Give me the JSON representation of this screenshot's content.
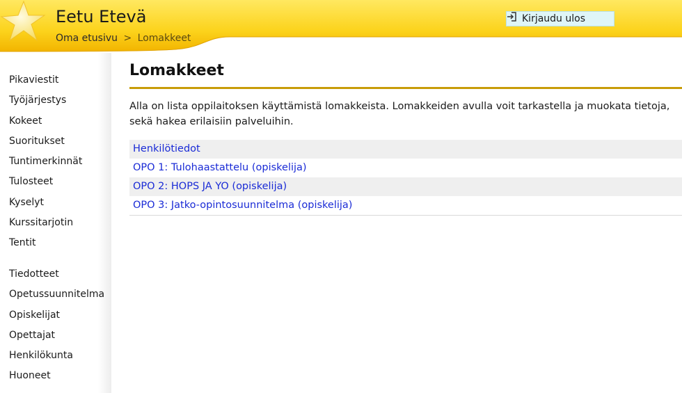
{
  "header": {
    "user_name": "Eetu Etevä",
    "breadcrumb": {
      "home": "Oma etusivu",
      "separator": ">",
      "current": "Lomakkeet"
    },
    "logout_label": "Kirjaudu ulos",
    "colors": {
      "banner_top": "#ffe45a",
      "banner_bottom": "#f5b800",
      "accent": "#c89c08"
    }
  },
  "sidebar": {
    "group1": [
      "Pikaviestit",
      "Työjärjestys",
      "Kokeet",
      "Suoritukset",
      "Tuntimerkinnät",
      "Tulosteet",
      "Kyselyt",
      "Kurssitarjotin",
      "Tentit"
    ],
    "group2": [
      "Tiedotteet",
      "Opetussuunnitelma",
      "Opiskelijat",
      "Opettajat",
      "Henkilökunta",
      "Huoneet"
    ]
  },
  "main": {
    "title": "Lomakkeet",
    "intro": "Alla on lista oppilaitoksen käyttämistä lomakkeista. Lomakkeiden avulla voit tarkastella ja muokata tietoja, sekä hakea erilaisiin palveluihin.",
    "forms": [
      "Henkilötiedot",
      "OPO 1: Tulohaastattelu (opiskelija)",
      "OPO 2: HOPS JA YO (opiskelija)",
      "OPO 3: Jatko-opintosuunnitelma (opiskelija)"
    ],
    "link_color": "#1a2bd6"
  }
}
